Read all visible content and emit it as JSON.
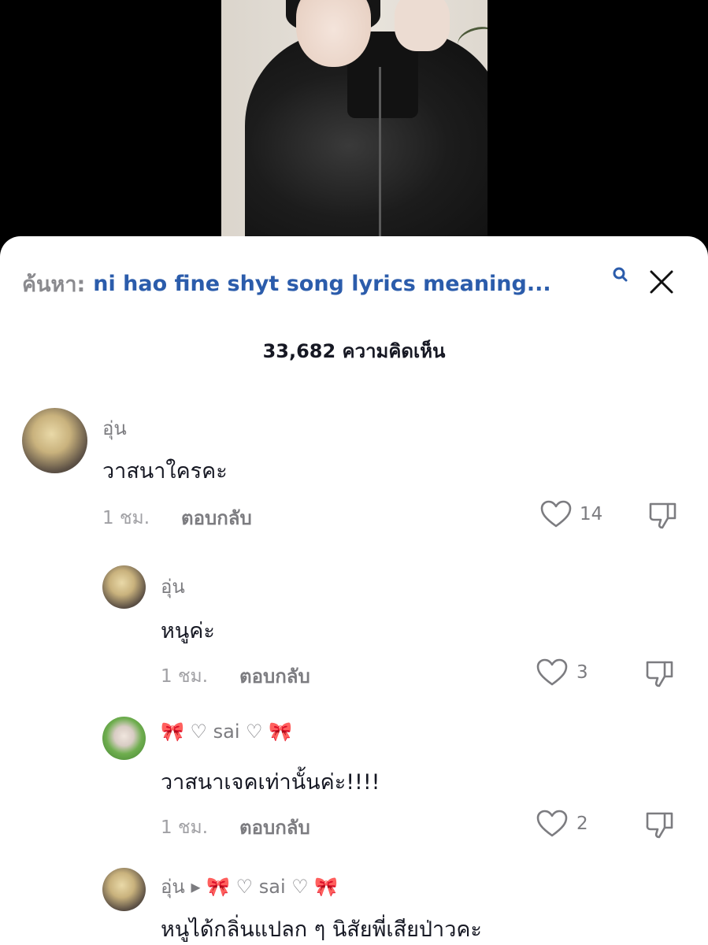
{
  "search": {
    "prefix": "ค้นหา:",
    "query": "ni hao fine shyt song lyrics meaning..."
  },
  "comment_count_label": "33,682 ความคิดเห็น",
  "comments": [
    {
      "username": "อุ่น",
      "text": "วาสนาใครคะ",
      "time": "1 ชม.",
      "reply_label": "ตอบกลับ",
      "likes": "14"
    },
    {
      "username": "อุ่น",
      "text": "หนูค่ะ",
      "time": "1 ชม.",
      "reply_label": "ตอบกลับ",
      "likes": "3"
    },
    {
      "username": "🎀 ♡ sai ♡ 🎀",
      "text": "วาสนาเจคเท่านั้นค่ะ!!!!",
      "time": "1 ชม.",
      "reply_label": "ตอบกลับ",
      "likes": "2"
    },
    {
      "username": "อุ่น ▸ 🎀 ♡ sai ♡ 🎀",
      "text": "หนูได้กลิ่นแปลก ๆ นิสัยพี่เสียป่าวคะ"
    }
  ],
  "colors": {
    "link_blue": "#2b5cab",
    "text_dark": "#161823",
    "text_gray": "#7c7c80"
  }
}
